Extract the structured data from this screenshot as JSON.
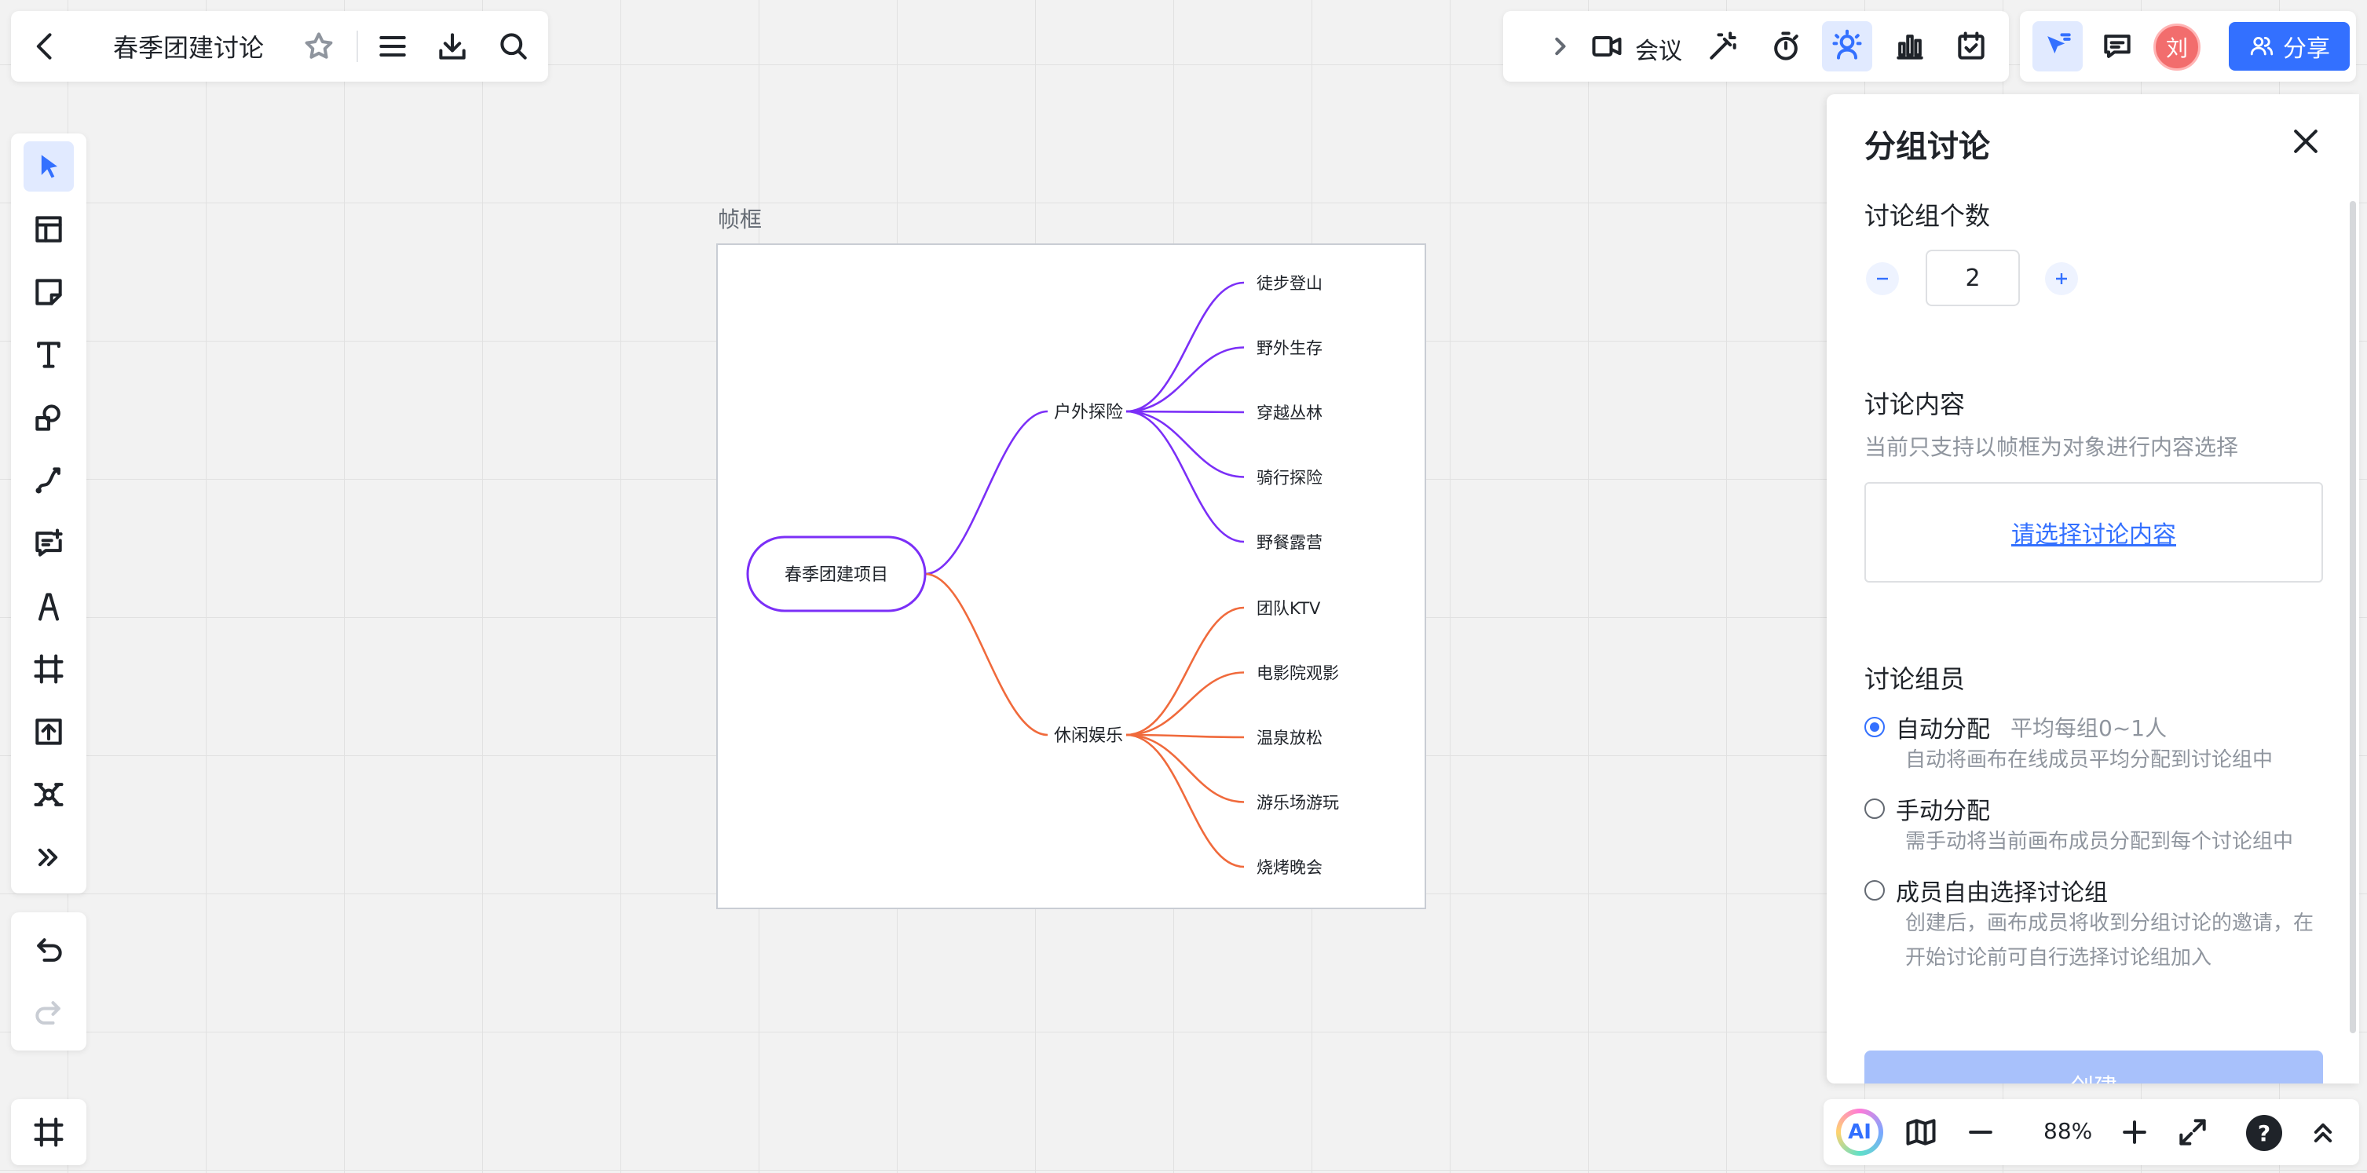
{
  "app": {
    "doc_title": "春季团建讨论"
  },
  "top_right": {
    "meeting_label": "会议",
    "share_label": "分享",
    "avatar_initial": "刘"
  },
  "canvas": {
    "frame_label": "帧框",
    "mindmap": {
      "root": "春季团建项目",
      "branches": [
        {
          "label": "户外探险",
          "color": "#7b2ff7",
          "children": [
            "徒步登山",
            "野外生存",
            "穿越丛林",
            "骑行探险",
            "野餐露营"
          ]
        },
        {
          "label": "休闲娱乐",
          "color": "#f06a3c",
          "children": [
            "团队KTV",
            "电影院观影",
            "温泉放松",
            "游乐场游玩",
            "烧烤晚会"
          ]
        }
      ]
    }
  },
  "side_panel": {
    "title": "分组讨论",
    "group_count_title": "讨论组个数",
    "group_count_value": "2",
    "content_title": "讨论内容",
    "content_hint": "当前只支持以帧框为对象进行内容选择",
    "content_link": "请选择讨论内容",
    "members_title": "讨论组员",
    "options": [
      {
        "label": "自动分配",
        "extra": "平均每组0~1人",
        "desc": "自动将画布在线成员平均分配到讨论组中",
        "checked": true
      },
      {
        "label": "手动分配",
        "extra": "",
        "desc": "需手动将当前画布成员分配到每个讨论组中",
        "checked": false
      },
      {
        "label": "成员自由选择讨论组",
        "extra": "",
        "desc": "创建后，画布成员将收到分组讨论的邀请，在开始讨论前可自行选择讨论组加入",
        "checked": false
      }
    ],
    "create_label": "创建"
  },
  "bottom_bar": {
    "ai_label": "AI",
    "zoom": "88%",
    "help": "?"
  },
  "colors": {
    "accent": "#3370ff",
    "branch_outdoor": "#7b2ff7",
    "branch_leisure": "#f06a3c"
  }
}
